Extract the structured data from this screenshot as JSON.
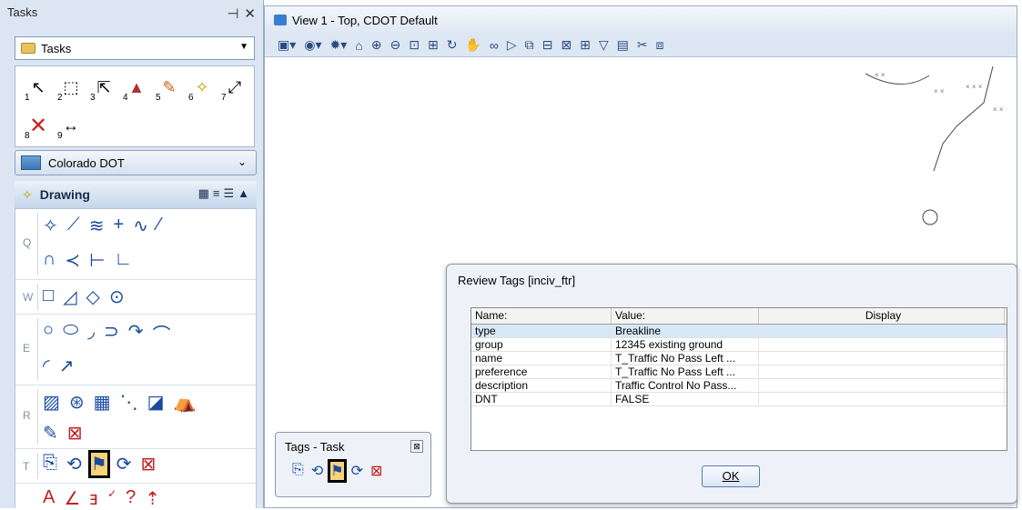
{
  "tasks_panel": {
    "title": "Tasks",
    "pin_glyph": "⊣",
    "close_glyph": "✕",
    "task_dropdown": "Tasks",
    "main_tools": [
      "1",
      "2",
      "3",
      "4",
      "5",
      "6",
      "7",
      "8",
      "9"
    ],
    "workflow": "Colorado DOT",
    "drawing_header": "Drawing",
    "group_letters": [
      "Q",
      "W",
      "E",
      "R",
      "T"
    ]
  },
  "view": {
    "title": "View 1 - Top, CDOT Default"
  },
  "review_dialog": {
    "title": "Review Tags [inciv_ftr]",
    "columns": [
      "Name:",
      "Value:",
      "Display"
    ],
    "rows": [
      {
        "name": "type",
        "value": "Breakline",
        "display": ""
      },
      {
        "name": "group",
        "value": "12345 existing ground",
        "display": ""
      },
      {
        "name": "name",
        "value": "T_Traffic No Pass Left ...",
        "display": ""
      },
      {
        "name": "preference",
        "value": "T_Traffic No Pass Left ...",
        "display": ""
      },
      {
        "name": "description",
        "value": "Traffic Control No Pass...",
        "display": ""
      },
      {
        "name": "DNT",
        "value": "FALSE",
        "display": ""
      }
    ],
    "ok_label": "OK"
  },
  "tags_task": {
    "title": "Tags - Task",
    "close_glyph": "⊠"
  }
}
